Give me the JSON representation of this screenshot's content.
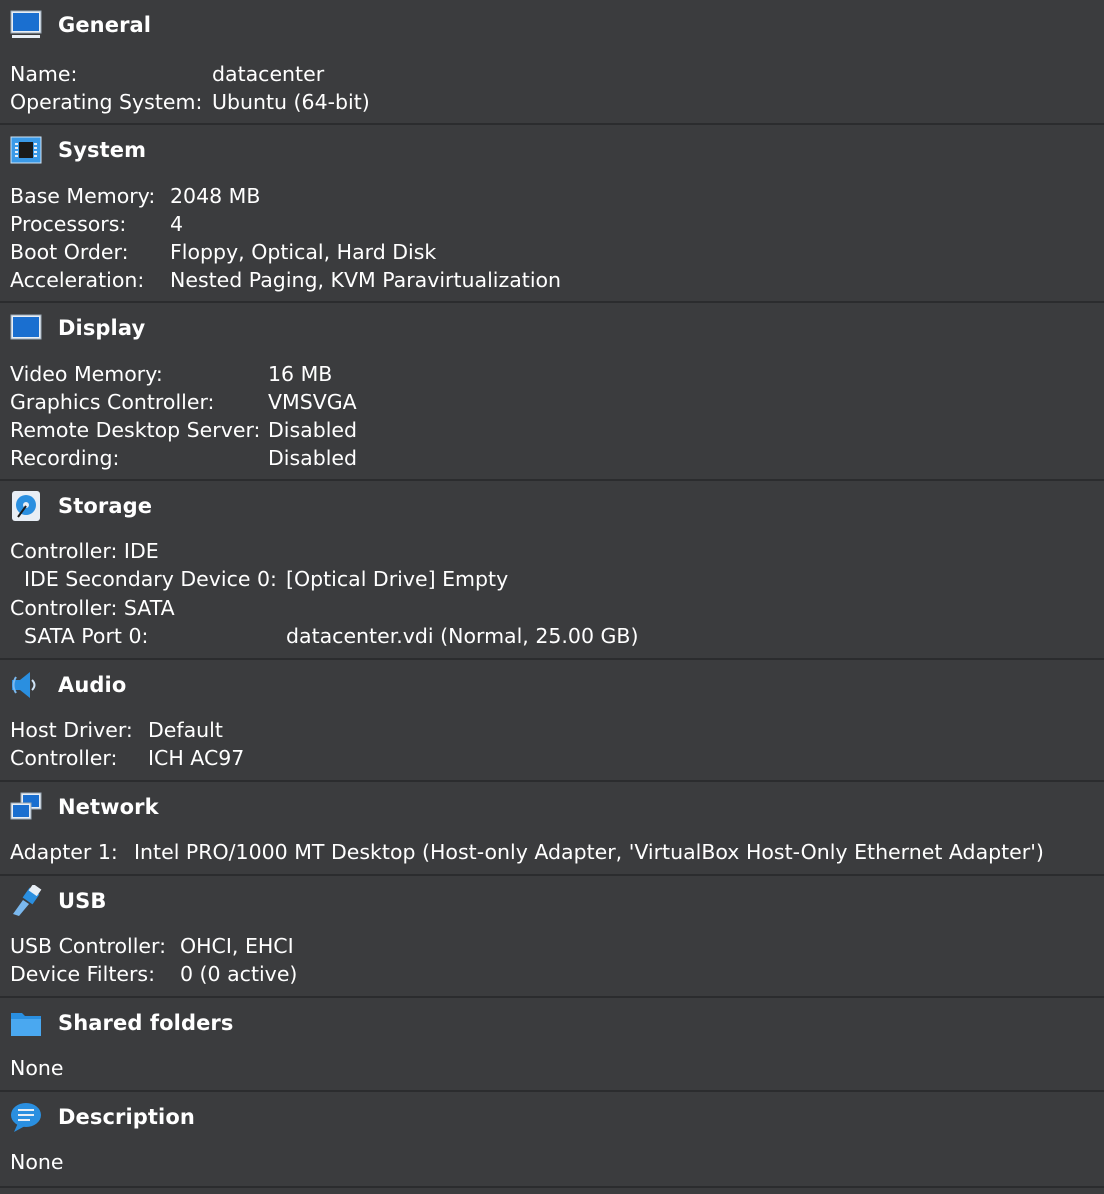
{
  "general": {
    "title": "General",
    "rows": [
      {
        "label": "Name:",
        "value": "datacenter"
      },
      {
        "label": "Operating System:",
        "value": "Ubuntu (64-bit)"
      }
    ]
  },
  "system": {
    "title": "System",
    "rows": [
      {
        "label": "Base Memory:",
        "value": "2048 MB"
      },
      {
        "label": "Processors:",
        "value": "4"
      },
      {
        "label": "Boot Order:",
        "value": "Floppy, Optical, Hard Disk"
      },
      {
        "label": "Acceleration:",
        "value": "Nested Paging, KVM Paravirtualization"
      }
    ]
  },
  "display": {
    "title": "Display",
    "rows": [
      {
        "label": "Video Memory:",
        "value": "16 MB"
      },
      {
        "label": "Graphics Controller:",
        "value": "VMSVGA"
      },
      {
        "label": "Remote Desktop Server:",
        "value": "Disabled"
      },
      {
        "label": "Recording:",
        "value": "Disabled"
      }
    ]
  },
  "storage": {
    "title": "Storage",
    "controller_ide": "Controller: IDE",
    "ide_device_label": "IDE Secondary Device 0:",
    "ide_device_value": "[Optical Drive] Empty",
    "controller_sata": "Controller: SATA",
    "sata_port_label": "SATA Port 0:",
    "sata_port_value": "datacenter.vdi (Normal, 25.00 GB)"
  },
  "audio": {
    "title": "Audio",
    "rows": [
      {
        "label": "Host Driver:",
        "value": "Default"
      },
      {
        "label": "Controller:",
        "value": "ICH AC97"
      }
    ]
  },
  "network": {
    "title": "Network",
    "rows": [
      {
        "label": "Adapter 1:",
        "value": "Intel PRO/1000 MT Desktop (Host-only Adapter, 'VirtualBox Host-Only Ethernet Adapter')"
      }
    ]
  },
  "usb": {
    "title": "USB",
    "rows": [
      {
        "label": "USB Controller:",
        "value": "OHCI, EHCI"
      },
      {
        "label": "Device Filters:",
        "value": "0 (0 active)"
      }
    ]
  },
  "shared_folders": {
    "title": "Shared folders",
    "value": "None"
  },
  "description": {
    "title": "Description",
    "value": "None"
  },
  "colors": {
    "background": "#3b3c3e",
    "separator": "#2b2c2e",
    "text": "#ffffff",
    "icon_blue": "#2a8fe0"
  }
}
